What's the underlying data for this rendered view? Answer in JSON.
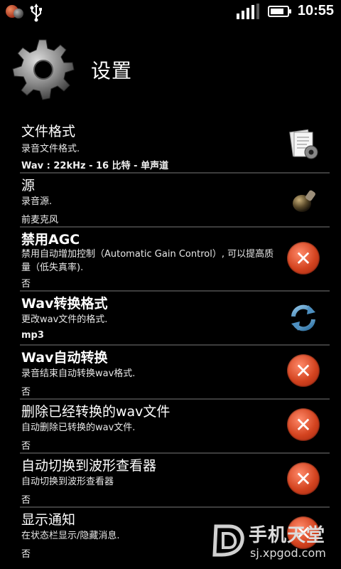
{
  "status_bar": {
    "time": "10:55",
    "icons": [
      "app-notification-icon",
      "usb-icon",
      "signal-icon",
      "battery-icon"
    ],
    "signal_level": 0.75,
    "battery_level": 0.7
  },
  "header": {
    "title": "设置",
    "icon": "gear-icon"
  },
  "settings": [
    {
      "title": "文件格式",
      "summary": "录音文件格式.",
      "value": "Wav : 22kHz - 16 比特 - 单声道",
      "icon": "file-format-icon"
    },
    {
      "title": "源",
      "summary": "录音源.",
      "value": "前麦克风",
      "icon": "microphone-icon"
    },
    {
      "title": "禁用AGC",
      "summary": "禁用自动增加控制（Automatic Gain Control）, 可以提高质量（低失真率).",
      "value": "否",
      "icon": "disabled-x-icon"
    },
    {
      "title": "Wav转换格式",
      "summary": "更改wav文件的格式.",
      "value": "mp3",
      "icon": "convert-refresh-icon"
    },
    {
      "title": "Wav自动转换",
      "summary": "录音结束自动转换wav格式.",
      "value": "否",
      "icon": "disabled-x-icon"
    },
    {
      "title": "删除已经转换的wav文件",
      "summary": "自动删除已转换的wav文件.",
      "value": "否",
      "icon": "disabled-x-icon"
    },
    {
      "title": "自动切换到波形查看器",
      "summary": "自动切换到波形查看器",
      "value": "否",
      "icon": "disabled-x-icon"
    },
    {
      "title": "显示通知",
      "summary": "在状态栏显示/隐藏消息.",
      "value": "否",
      "icon": "disabled-x-icon"
    }
  ],
  "watermark": {
    "name": "手机天堂",
    "url": "sj.xpgod.com"
  }
}
